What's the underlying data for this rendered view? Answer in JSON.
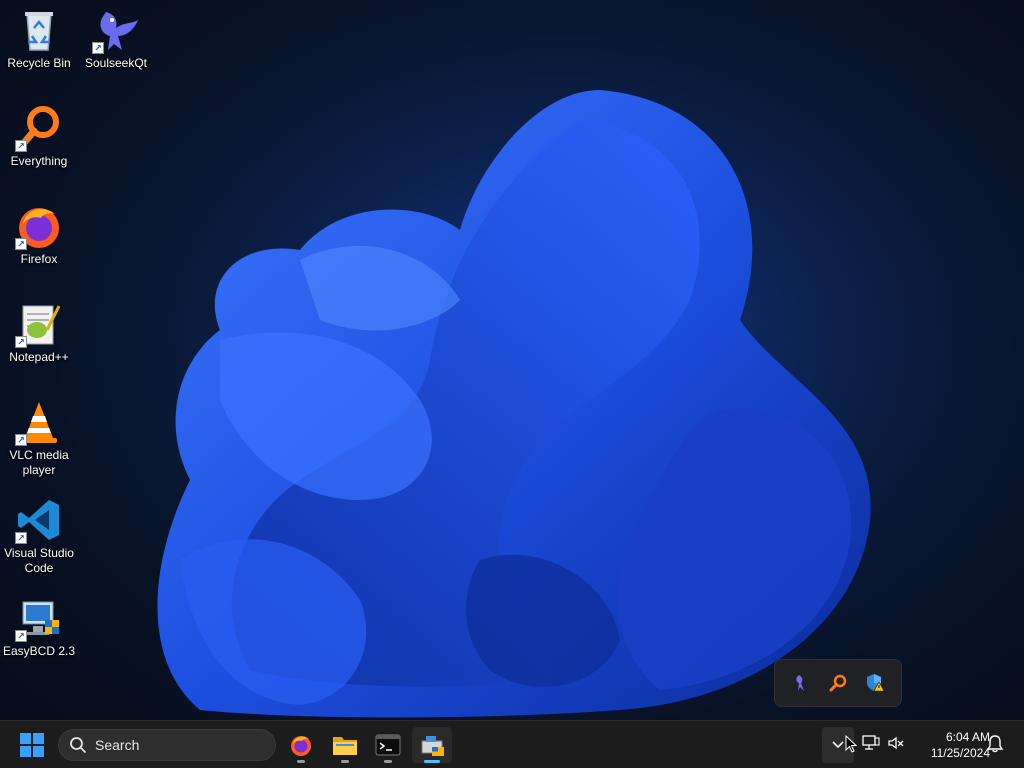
{
  "desktop": {
    "icons": [
      {
        "label": "Recycle Bin",
        "icon": "recycle-bin-icon"
      },
      {
        "label": "SoulseekQt",
        "icon": "soulseek-icon"
      },
      {
        "label": "Everything",
        "icon": "everything-search-icon"
      },
      {
        "label": "Firefox",
        "icon": "firefox-icon"
      },
      {
        "label": "Notepad++",
        "icon": "notepadpp-icon"
      },
      {
        "label": "VLC media player",
        "icon": "vlc-icon"
      },
      {
        "label": "Visual Studio Code",
        "icon": "vscode-icon"
      },
      {
        "label": "EasyBCD 2.3",
        "icon": "easybcd-icon"
      }
    ]
  },
  "taskbar": {
    "search_label": "Search",
    "apps": [
      {
        "name": "Firefox",
        "icon": "firefox-icon"
      },
      {
        "name": "File Explorer",
        "icon": "folder-icon"
      },
      {
        "name": "Terminal",
        "icon": "terminal-icon"
      },
      {
        "name": "Setup",
        "icon": "installer-icon"
      }
    ],
    "clock": {
      "time": "6:04 AM",
      "date": "11/25/2024"
    }
  },
  "tray_flyout": {
    "icons": [
      "soulseek-icon",
      "everything-search-icon",
      "security-warning-icon"
    ]
  },
  "colors": {
    "taskbar": "#1c1c1c",
    "accent": "#4cc2ff",
    "wallpaper_bloom": "#1f4ed8"
  }
}
